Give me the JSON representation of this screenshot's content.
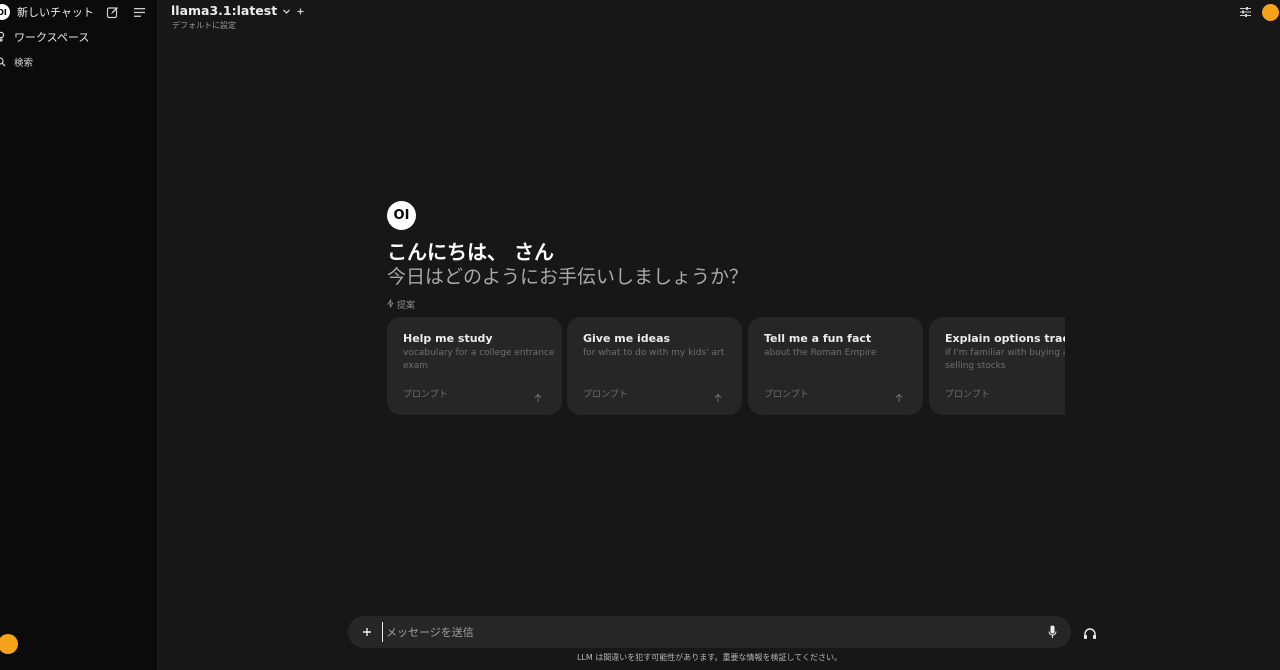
{
  "sidebar": {
    "new_chat_label": "新しいチャット",
    "logo_text": "OI",
    "workspace_label": "ワークスペース",
    "search_label": "検索",
    "icons": [
      "edit-icon",
      "menu-icon",
      "workspace-icon",
      "search-icon"
    ]
  },
  "header": {
    "model_name": "llama3.1:latest",
    "set_default_label": "デフォルトに設定",
    "icons": [
      "chevron-down-icon",
      "plus-icon",
      "controls-icon"
    ]
  },
  "welcome": {
    "logo_text": "OI",
    "greeting": "こんにちは、 さん",
    "subtitle": "今日はどのようにお手伝いしましょうか？",
    "suggestion_label": "提案"
  },
  "suggestions": [
    {
      "title": "Help me study",
      "subtitle": "vocabulary for a college entrance exam",
      "footer": "プロンプト"
    },
    {
      "title": "Give me ideas",
      "subtitle": "for what to do with my kids' art",
      "footer": "プロンプト"
    },
    {
      "title": "Tell me a fun fact",
      "subtitle": "about the Roman Empire",
      "footer": "プロンプト"
    },
    {
      "title": "Explain options trading",
      "subtitle": "if I'm familiar with buying and selling stocks",
      "footer": "プロンプト"
    }
  ],
  "input": {
    "placeholder": "メッセージを送信",
    "value": ""
  },
  "disclaimer": "LLM は間違いを犯す可能性があります。重要な情報を検証してください。",
  "colors": {
    "background": "#171717",
    "sidebar": "#0b0b0b",
    "card": "#262626",
    "avatar": "#f7a21b"
  }
}
